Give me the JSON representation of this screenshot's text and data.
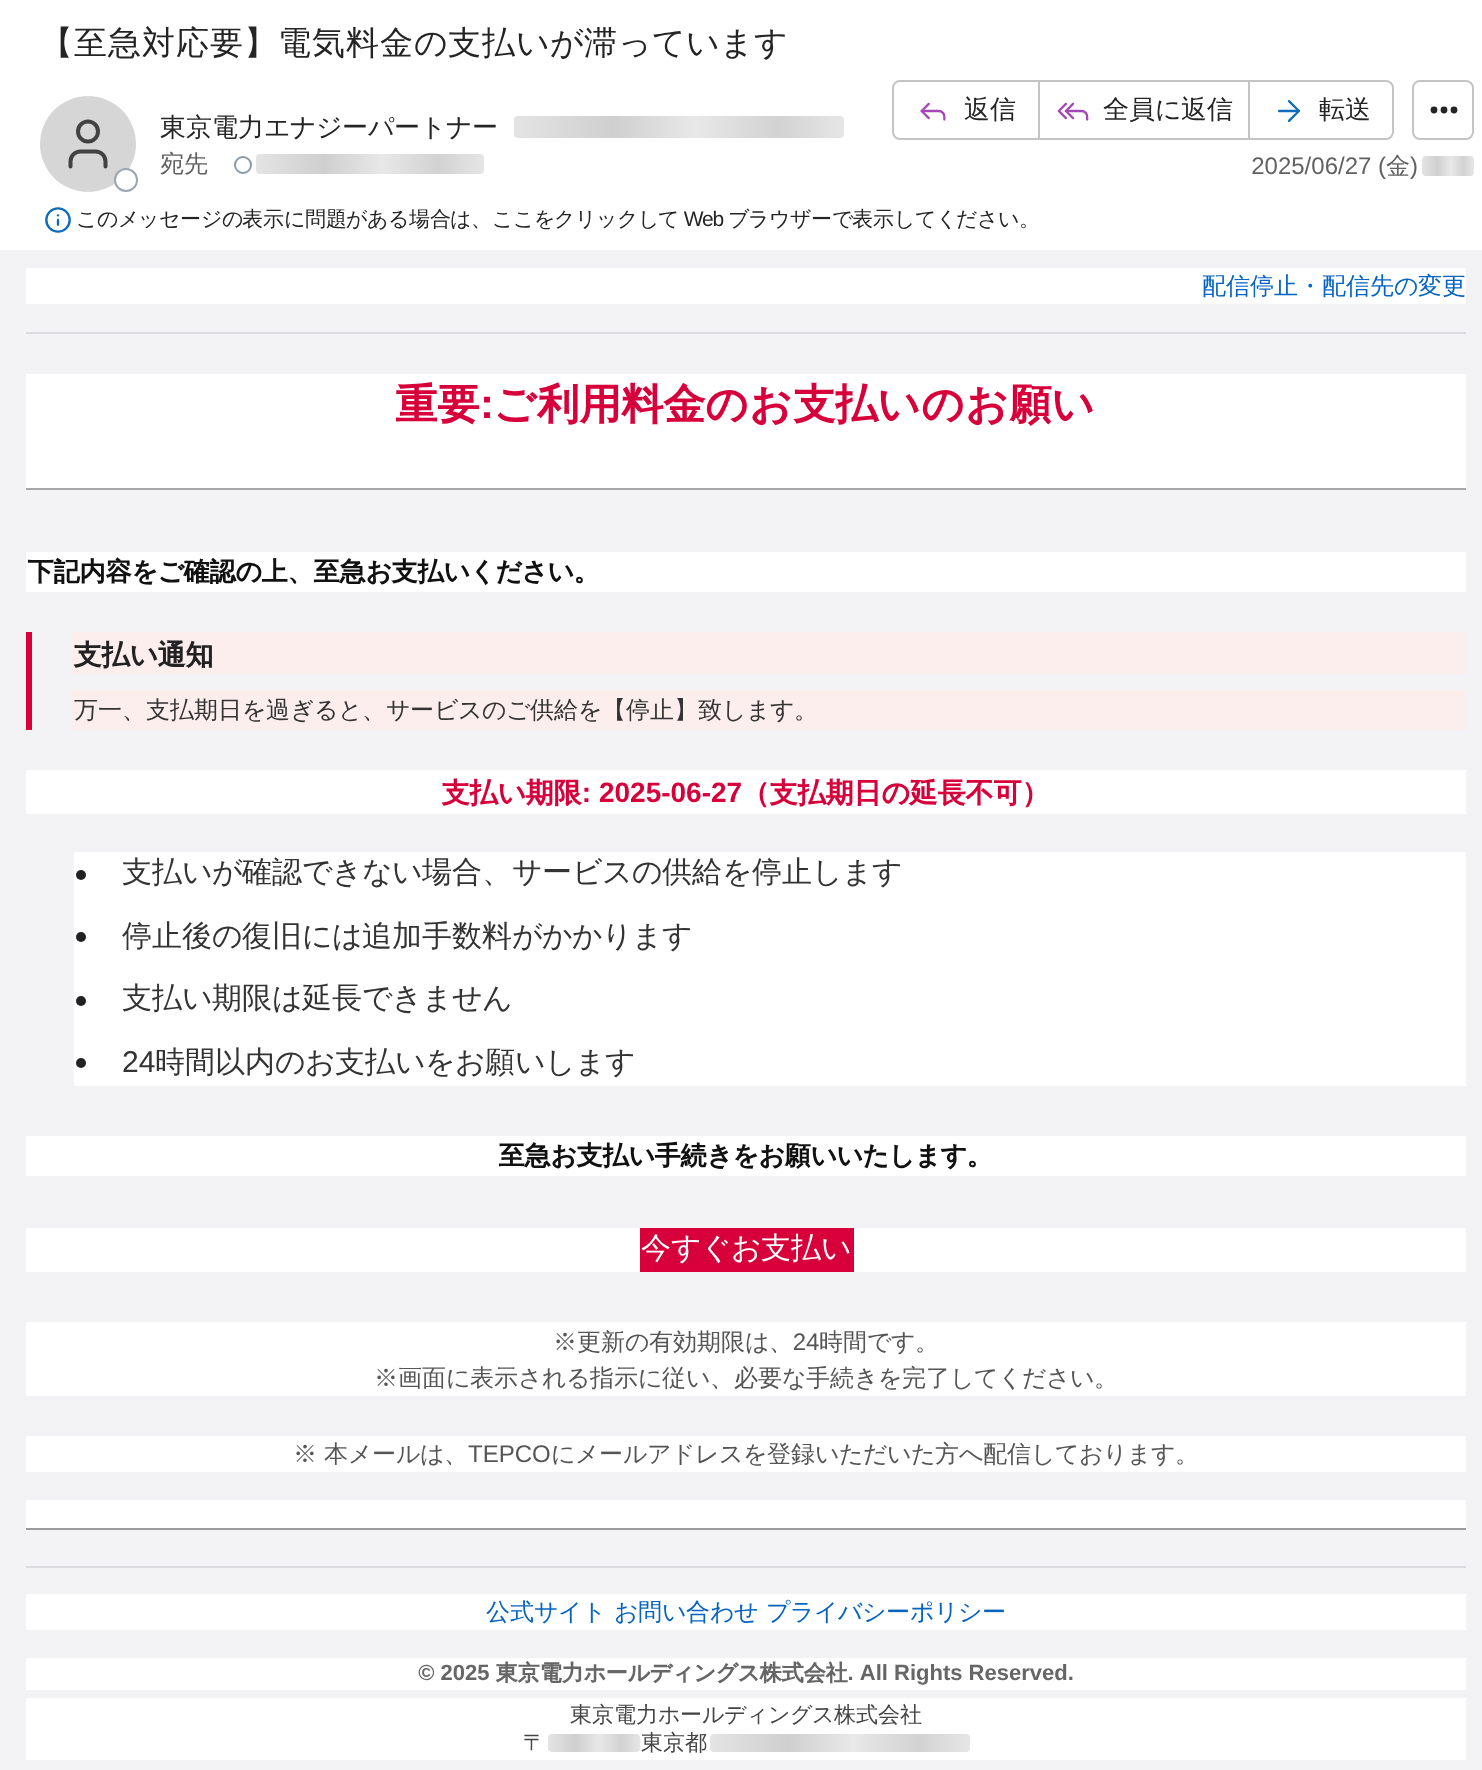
{
  "message": {
    "subject": "【至急対応要】電気料金の支払いが滞っています",
    "sender": "東京電力エナジーパートナー",
    "recipient_label": "宛先",
    "date": "2025/06/27 (金)",
    "info_bar": "このメッセージの表示に問題がある場合は、ここをクリックして Web ブラウザーで表示してください。"
  },
  "actions": [
    {
      "kind": "reply",
      "label": "返信"
    },
    {
      "kind": "reply_all",
      "label": "全員に返信"
    },
    {
      "kind": "forward",
      "label": "転送"
    }
  ],
  "body": {
    "unsubscribe_link": "配信停止・配信先の変更",
    "heading": "重要:ご利用料金のお支払いのお願い",
    "intro": "下記内容をご確認の上、至急お支払いください。",
    "notice": {
      "title": "支払い通知",
      "text": "万一、支払期日を過ぎると、サービスのご供給を【停止】致します。"
    },
    "deadline": "支払い期限: 2025-06-27（支払期日の延長不可）",
    "bullets": [
      "支払いが確認できない場合、サービスの供給を停止します",
      "停止後の復旧には追加手数料がかかります",
      "支払い期限は延長できません",
      "24時間以内のお支払いをお願いします"
    ],
    "urgent_request": "至急お支払い手続きをお願いいたします。",
    "pay_button": "今すぐお支払い",
    "notes": [
      "※更新の有効期限は、24時間です。",
      "※画面に表示される指示に従い、必要な手続きを完了してください。"
    ],
    "disclaimer": "※ 本メールは、TEPCOにメールアドレスを登録いただいた方へ配信しております。"
  },
  "footer": {
    "links": [
      "公式サイト",
      "お問い合わせ",
      "プライバシーポリシー"
    ],
    "copyright": "© 2025 東京電力ホールディングス株式会社. All Rights Reserved.",
    "company": "東京電力ホールディングス株式会社",
    "postal_mark": "〒",
    "prefecture": "東京都"
  }
}
